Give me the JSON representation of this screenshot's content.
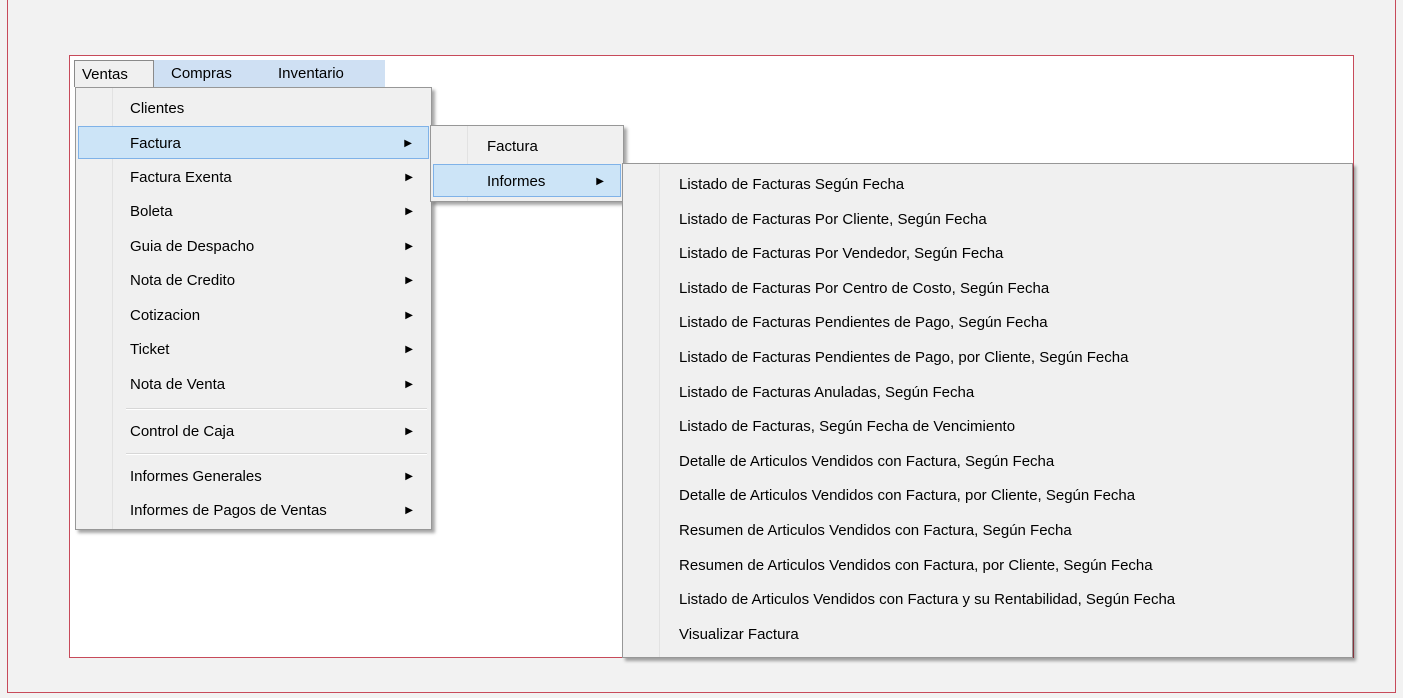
{
  "menubar": {
    "items": [
      {
        "label": "Ventas"
      },
      {
        "label": "Compras"
      },
      {
        "label": "Inventario"
      }
    ]
  },
  "ventas_menu": {
    "items": [
      {
        "label": "Clientes"
      },
      {
        "label": "Factura",
        "arrow": "▶"
      },
      {
        "label": "Factura Exenta",
        "arrow": "▶"
      },
      {
        "label": "Boleta",
        "arrow": "▶"
      },
      {
        "label": "Guia de Despacho",
        "arrow": "▶"
      },
      {
        "label": "Nota de Credito",
        "arrow": "▶"
      },
      {
        "label": "Cotizacion",
        "arrow": "▶"
      },
      {
        "label": "Ticket",
        "arrow": "▶"
      },
      {
        "label": "Nota de Venta",
        "arrow": "▶"
      },
      {
        "label": "Control de Caja",
        "arrow": "▶"
      },
      {
        "label": "Informes Generales",
        "arrow": "▶"
      },
      {
        "label": "Informes de Pagos de Ventas",
        "arrow": "▶"
      }
    ]
  },
  "factura_menu": {
    "items": [
      {
        "label": "Factura"
      },
      {
        "label": "Informes",
        "arrow": "▶"
      }
    ]
  },
  "informes_menu": {
    "items": [
      {
        "label": "Listado de Facturas Según Fecha"
      },
      {
        "label": "Listado de Facturas Por Cliente, Según Fecha"
      },
      {
        "label": "Listado de Facturas Por Vendedor, Según Fecha"
      },
      {
        "label": "Listado de Facturas Por Centro de Costo, Según Fecha"
      },
      {
        "label": "Listado de Facturas Pendientes de Pago, Según Fecha"
      },
      {
        "label": "Listado de Facturas Pendientes de Pago, por Cliente, Según Fecha"
      },
      {
        "label": "Listado de Facturas Anuladas, Según Fecha"
      },
      {
        "label": "Listado de Facturas, Según Fecha de Vencimiento"
      },
      {
        "label": "Detalle de Articulos Vendidos con Factura, Según Fecha"
      },
      {
        "label": "Detalle de Articulos Vendidos con Factura, por Cliente,  Según Fecha"
      },
      {
        "label": "Resumen de Articulos Vendidos con Factura, Según Fecha"
      },
      {
        "label": "Resumen de Articulos Vendidos con Factura, por Cliente, Según Fecha"
      },
      {
        "label": "Listado de Articulos Vendidos con Factura y su Rentabilidad, Según Fecha"
      },
      {
        "label": "Visualizar Factura"
      }
    ]
  },
  "colors": {
    "frame_border": "#c74a5a",
    "menubar_bg": "#cfe0f3",
    "highlight_bg": "#cce4f7",
    "highlight_border": "#7fb2e8"
  }
}
